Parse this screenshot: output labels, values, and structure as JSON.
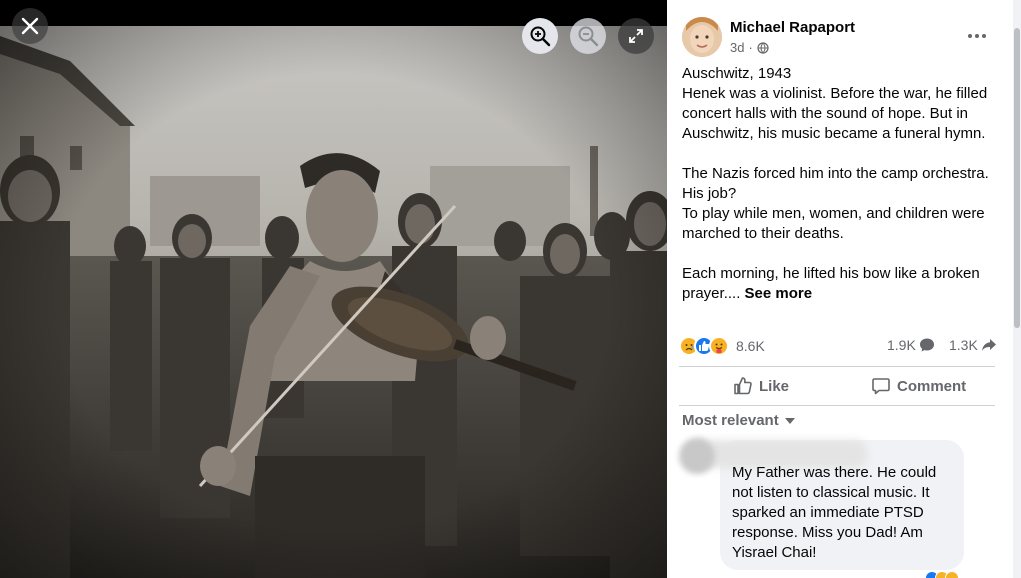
{
  "viewer": {
    "close_icon": "close-icon",
    "zoom_in_icon": "zoom-in-icon",
    "zoom_out_icon": "zoom-out-icon",
    "fullscreen_icon": "fullscreen-icon",
    "photo_icon": "photo-image"
  },
  "post": {
    "author": "Michael Rapaport",
    "time": "3d",
    "audience_icon": "globe-icon",
    "more_icon": "more-options-icon",
    "lines": [
      "Auschwitz, 1943",
      "Henek was a violinist. Before the war, he filled",
      "concert halls with the sound of hope. But in",
      "Auschwitz, his music became a funeral hymn.",
      "",
      "The Nazis forced him into the camp orchestra.",
      "His job?",
      "To play while men, women, and children were",
      "marched to their deaths.",
      "",
      "Each morning, he lifted his bow like a broken"
    ],
    "last_line": "prayer....",
    "see_more": "See more"
  },
  "stats": {
    "reaction_count": "8.6K",
    "comments": "1.9K",
    "shares": "1.3K",
    "reaction_icons": [
      "sad-reaction-icon",
      "like-reaction-icon",
      "care-reaction-icon"
    ]
  },
  "actions": {
    "like": "Like",
    "comment": "Comment"
  },
  "comments": {
    "sort_label": "Most relevant",
    "first": {
      "lines": [
        "My Father was there. He could",
        "not listen to classical music. It",
        "sparked an immediate PTSD",
        "response. Miss you Dad! Am",
        "Yisrael Chai!"
      ]
    }
  },
  "colors": {
    "accent": "#1877f2",
    "secondary_text": "#65676b",
    "bubble": "#f0f2f5"
  }
}
